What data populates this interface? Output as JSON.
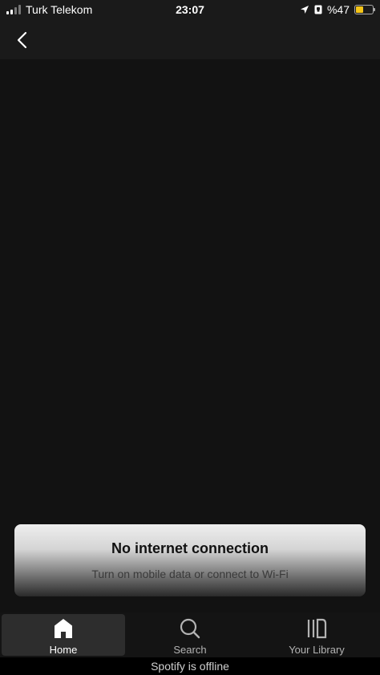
{
  "status_bar": {
    "carrier": "Turk Telekom",
    "time": "23:07",
    "battery_text": "%47",
    "battery_level": 0.47,
    "battery_color": "#f5c518"
  },
  "header": {
    "back_icon": "chevron-left-icon"
  },
  "toast": {
    "title": "No internet connection",
    "message": "Turn on mobile data or connect to Wi-Fi"
  },
  "bottom_nav": {
    "items": [
      {
        "label": "Home",
        "icon": "home-icon",
        "active": true
      },
      {
        "label": "Search",
        "icon": "search-icon",
        "active": false
      },
      {
        "label": "Your Library",
        "icon": "library-icon",
        "active": false
      }
    ]
  },
  "offline_banner": "Spotify is offline",
  "colors": {
    "background": "#121212",
    "nav_active_bg": "#2d2d2d"
  }
}
